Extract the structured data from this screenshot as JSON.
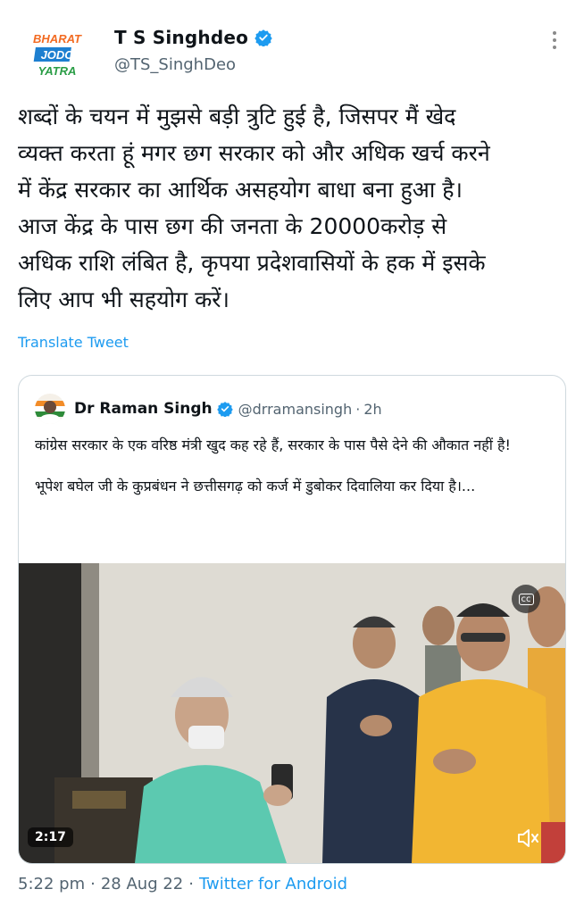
{
  "tweet": {
    "author_name": "T S Singhdeo",
    "author_handle": "@TS_SinghDeo",
    "avatar_text": [
      "BHARAT",
      "JODO",
      "YATRA"
    ],
    "text_lines": [
      "शब्दों के चयन में मुझसे बड़ी त्रुटि हुई है, जिसपर मैं खेद",
      "व्यक्त करता हूं मगर छग सरकार को और अधिक खर्च करने",
      "में केंद्र सरकार का आर्थिक असहयोग बाधा बना हुआ है।",
      "आज केंद्र के पास छग की जनता के 20000करोड़ से",
      "अधिक राशि लंबित है, कृपया प्रदेशवासियों के हक में इसके",
      "लिए आप भी सहयोग करें।"
    ],
    "translate_label": "Translate Tweet",
    "time": "5:22 pm",
    "date": "28 Aug 22",
    "source": "Twitter for Android",
    "separator": "·"
  },
  "quoted": {
    "author_name": "Dr Raman Singh",
    "author_handle": "@drramansingh",
    "separator": "·",
    "age": "2h",
    "paragraph_1": "कांग्रेस सरकार के एक वरिष्ठ मंत्री खुद कह रहे हैं, सरकार के पास पैसे देने की औकात नहीं है!",
    "paragraph_2": "भूपेश बघेल जी के कुप्रबंधन ने छत्तीसगढ़ को कर्ज में डुबोकर दिवालिया कर दिया है।...",
    "video": {
      "duration": "2:17",
      "cc_label": "cc"
    }
  },
  "colors": {
    "text_primary": "#0f1419",
    "text_secondary": "#536471",
    "link_blue": "#1d9bf0",
    "verified_blue": "#1d9bf0",
    "card_border": "#cfd9de"
  },
  "icons": {
    "verified": "verified-badge-icon",
    "more": "more-vertical-icon",
    "mute": "volume-mute-icon",
    "cc": "closed-captions-icon"
  }
}
